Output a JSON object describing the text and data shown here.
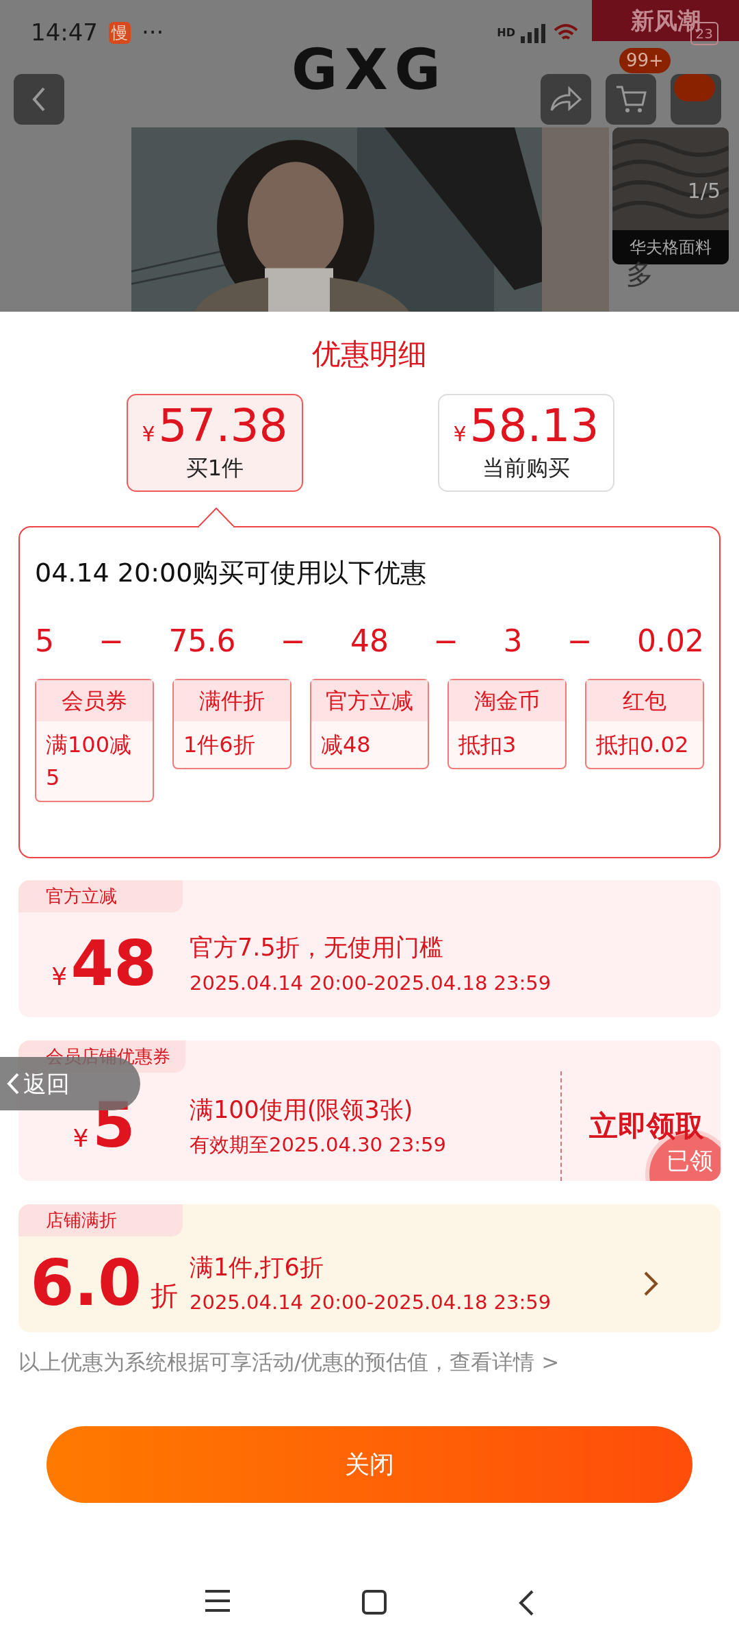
{
  "status_bar": {
    "time": "14:47",
    "app_badge": "慢",
    "more": "···",
    "network": "HD",
    "battery": "23"
  },
  "banner": "新风潮",
  "header": {
    "logo": "GXG",
    "cart_badge": "99+"
  },
  "gallery": {
    "counter": "1/5",
    "thumb_caption": "华夫格面料",
    "side_text": "多"
  },
  "sheet": {
    "title": "优惠明细",
    "options": [
      {
        "currency": "¥",
        "price": "57.38",
        "label": "买1件",
        "selected": true
      },
      {
        "currency": "¥",
        "price": "58.13",
        "label": "当前购买",
        "selected": false
      }
    ],
    "detail": {
      "heading": "04.14 20:00购买可使用以下优惠",
      "minus": "−",
      "items": [
        {
          "amount": "5",
          "title": "会员券",
          "desc": "满100减5"
        },
        {
          "amount": "75.6",
          "title": "满件折",
          "desc": "1件6折"
        },
        {
          "amount": "48",
          "title": "官方立减",
          "desc": "减48"
        },
        {
          "amount": "3",
          "title": "淘金币",
          "desc": "抵扣3"
        },
        {
          "amount": "0.02",
          "title": "红包",
          "desc": "抵扣0.02"
        }
      ]
    },
    "coupons": [
      {
        "kind": "amount",
        "tag": "官方立减",
        "symbol": "¥",
        "value": "48",
        "title": "官方7.5折，无使用门槛",
        "period": "2025.04.14 20:00-2025.04.18 23:59"
      },
      {
        "kind": "amount",
        "tag": "会员店铺优惠券",
        "symbol": "¥",
        "value": "5",
        "title": "满100使用(限领3张)",
        "period": "有效期至2025.04.30 23:59",
        "action": "立即领取",
        "stamp": "已领"
      },
      {
        "kind": "discount",
        "tag": "店铺满折",
        "value": "6.0",
        "symbol": "折",
        "title": "满1件,打6折",
        "period": "2025.04.14 20:00-2025.04.18 23:59"
      }
    ],
    "note": "以上优惠为系统根据可享活动/优惠的预估值，查看详情 >",
    "close_button": "关闭"
  },
  "float_back": "返回"
}
